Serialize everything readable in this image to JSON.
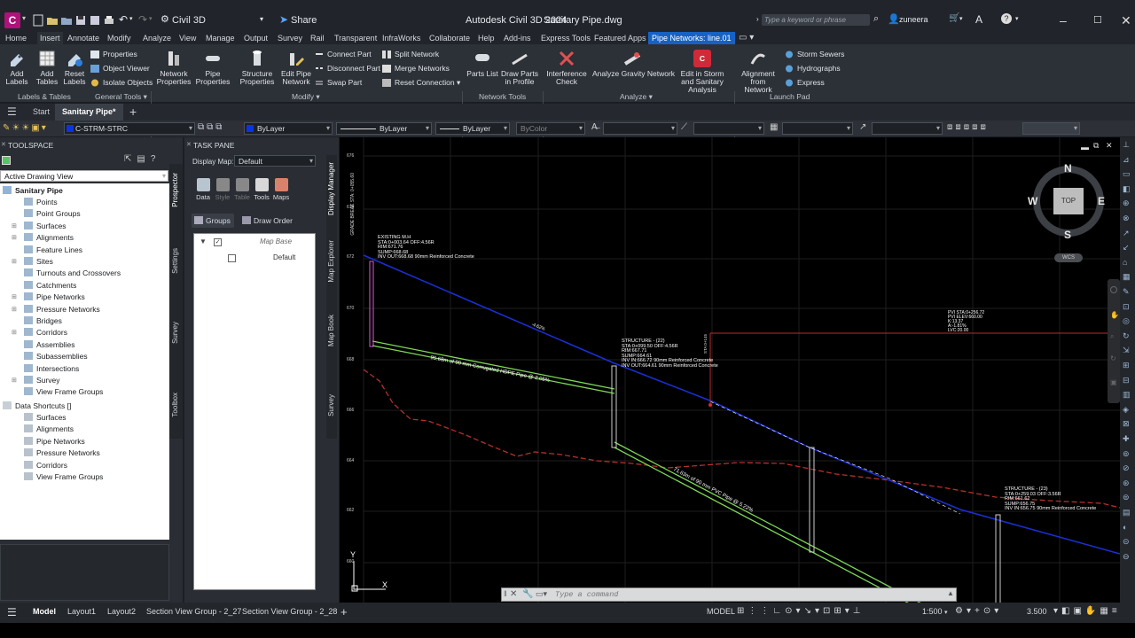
{
  "app": {
    "title": "Autodesk Civil 3D 2024",
    "filename": "Sanitary Pipe.dwg",
    "workspace": "Civil 3D",
    "share_label": "Share",
    "search_placeholder": "Type a keyword or phrase",
    "user": "zuneera",
    "logo_letter": "C"
  },
  "menu": {
    "items": [
      "Home",
      "Insert",
      "Annotate",
      "Modify",
      "Analyze",
      "View",
      "Manage",
      "Output",
      "Survey",
      "Rail",
      "Transparent",
      "InfraWorks",
      "Collaborate",
      "Help",
      "Add-ins",
      "Express Tools",
      "Featured Apps"
    ],
    "active_contextual": "Pipe Networks: line.01"
  },
  "ribbon": {
    "labels_tables": {
      "add_labels": "Add Labels",
      "add_tables": "Add Tables",
      "reset_labels": "Reset Labels",
      "title": "Labels & Tables"
    },
    "general_tools": {
      "properties": "Properties",
      "object_viewer": "Object Viewer",
      "isolate_objects": "Isolate Objects",
      "title": "General Tools"
    },
    "modify": {
      "network_properties": "Network Properties",
      "pipe_properties": "Pipe Properties",
      "structure_properties": "Structure Properties",
      "edit_pipe_network": "Edit Pipe Network",
      "connect_part": "Connect Part",
      "disconnect_part": "Disconnect Part",
      "swap_part": "Swap Part",
      "split_network": "Split Network",
      "merge_networks": "Merge Networks",
      "reset_connection": "Reset Connection",
      "title": "Modify"
    },
    "network_tools": {
      "parts_list": "Parts List",
      "draw_parts_in_profile": "Draw Parts in Profile",
      "title": "Network Tools"
    },
    "analyze": {
      "interference_check": "Interference Check",
      "analyze_gravity": "Analyze Gravity Network",
      "edit_storm": "Edit in Storm and Sanitary Analysis",
      "title": "Analyze"
    },
    "launch_pad": {
      "alignment_from_network": "Alignment from Network",
      "storm_sewers": "Storm Sewers",
      "hydrographs": "Hydrographs",
      "express": "Express",
      "title": "Launch Pad"
    }
  },
  "doc_tabs": {
    "start": "Start",
    "active": "Sanitary Pipe*"
  },
  "properties_bar": {
    "layer": "C-STRM-STRC",
    "color": "ByLayer",
    "linetype": "ByLayer",
    "lineweight": "ByLayer",
    "plotstyle": "ByColor"
  },
  "toolspace": {
    "title": "TOOLSPACE",
    "view_select": "Active Drawing View",
    "root": "Sanitary Pipe",
    "items": [
      "Points",
      "Point Groups",
      "Surfaces",
      "Alignments",
      "Feature Lines",
      "Sites",
      "Turnouts and Crossovers",
      "Catchments",
      "Pipe Networks",
      "Pressure Networks",
      "Bridges",
      "Corridors",
      "Assemblies",
      "Subassemblies",
      "Intersections",
      "Survey",
      "View Frame Groups"
    ],
    "shortcuts_root": "Data Shortcuts []",
    "shortcut_items": [
      "Surfaces",
      "Alignments",
      "Pipe Networks",
      "Pressure Networks",
      "Corridors",
      "View Frame Groups"
    ],
    "side_tabs": [
      "Prospector",
      "Settings",
      "Survey",
      "Toolbox"
    ]
  },
  "taskpane": {
    "title": "TASK PANE",
    "display_map_label": "Display Map:",
    "display_map_value": "Default",
    "tools": [
      "Data",
      "Style",
      "Table",
      "Tools",
      "Maps"
    ],
    "groups_tab": "Groups",
    "draw_order_tab": "Draw Order",
    "map_base": "Map Base",
    "default_layer": "Default",
    "side_tabs": [
      "Display Manager",
      "Map Explorer",
      "Map Book",
      "Survey"
    ]
  },
  "drawing": {
    "y_ticks": [
      "676",
      "674",
      "672",
      "670",
      "668",
      "666",
      "664",
      "662",
      "660"
    ],
    "existing_mh": [
      "EXISTING M.H",
      "STA:0+003.64  OFF:4.56R",
      "RIM:671.76",
      "SUMP:668.68",
      "INV OUT:668.68  90mm Reinforced Concrete"
    ],
    "structure_22": [
      "STRUCTURE - (22)",
      "STA:0+099.50  OFF:4.56R",
      "RIM:667.71",
      "SUMP:664.61",
      "INV IN:666.72  90mm Reinforced Concrete",
      "INV OUT:664.61  90mm Reinforced Concrete"
    ],
    "structure_23": [
      "STRUCTURE - (23)",
      "STA:0+259.03  OFF:3.56R",
      "RIM:661.62",
      "SUMP:656.75",
      "INV IN:656.75  90mm Reinforced Concrete"
    ],
    "pvi": [
      "PVI STA:0+256.72",
      "PVI ELEV:660.00",
      "K:13.37",
      "A:-1.81%",
      "LVC:20.00"
    ],
    "pipe1_label": "95.68m of 90 mm Corrugated HDPE Pipe @ 2.05%",
    "pipe2_label": "71.63m of 90 mm PVC Pipe @ 5.22%",
    "grade_label": "-4.62%",
    "vertical_text": "GRADE BREAK STA: 0+055.60",
    "compass": {
      "n": "N",
      "s": "S",
      "e": "E",
      "w": "W",
      "top": "TOP",
      "wcs": "WCS"
    },
    "command_placeholder": "Type a command",
    "ucs_y": "Y",
    "ucs_x": "X"
  },
  "status": {
    "tabs": [
      "Model",
      "Layout1",
      "Layout2",
      "Section View Group - 2_27",
      "Section View Group - 2_28"
    ],
    "model_label": "MODEL",
    "scale": "1:500",
    "value": "3.500"
  },
  "colors": {
    "accent": "#1662c4",
    "pipe_green": "#7ed957",
    "profile_blue": "#1a2fd6",
    "surface_red": "#c0392b"
  }
}
